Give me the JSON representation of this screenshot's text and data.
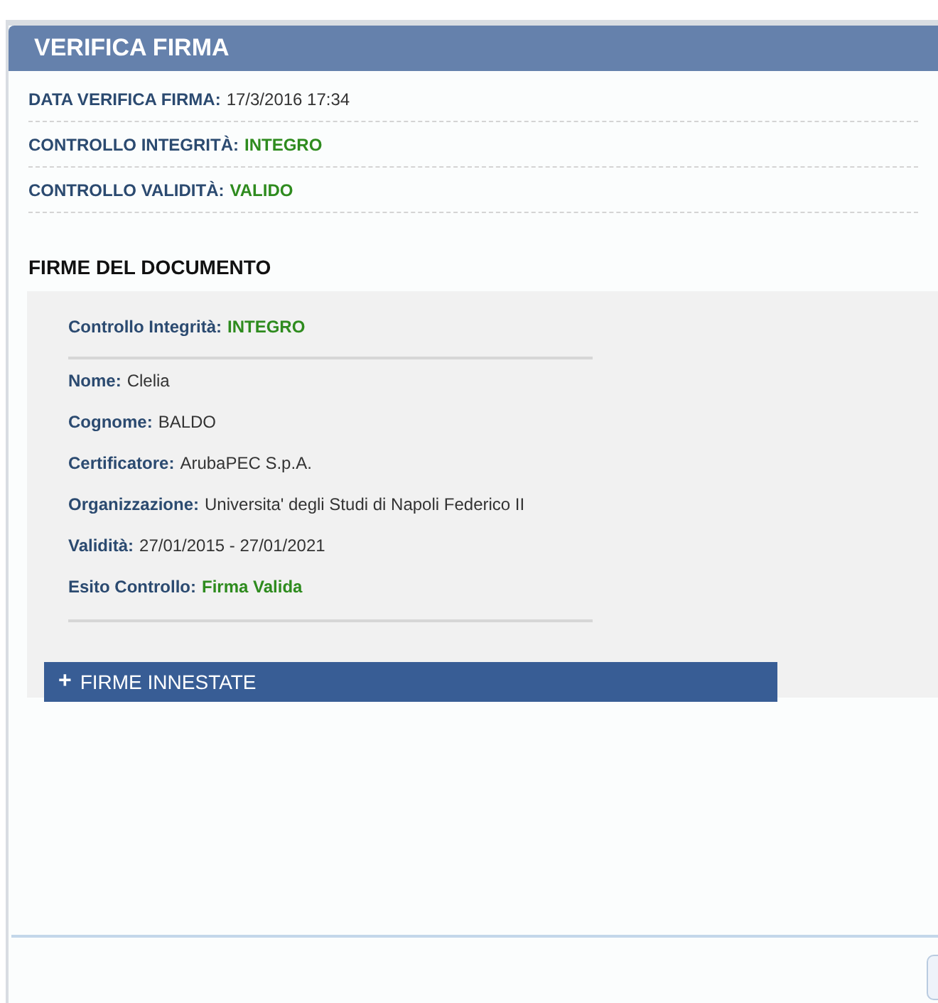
{
  "dialog": {
    "title": "VERIFICA FIRMA"
  },
  "summary": [
    {
      "label": "DATA VERIFICA FIRMA:",
      "value": "17/3/2016 17:34",
      "kind": "text"
    },
    {
      "label": "CONTROLLO INTEGRITÀ:",
      "value": "INTEGRO",
      "kind": "status"
    },
    {
      "label": "CONTROLLO VALIDITÀ:",
      "value": "VALIDO",
      "kind": "status"
    }
  ],
  "signatures": {
    "title": "FIRME DEL DOCUMENTO",
    "integrity": {
      "label": "Controllo Integrità:",
      "value": "INTEGRO",
      "kind": "status"
    },
    "fields": [
      {
        "label": "Nome:",
        "value": "Clelia",
        "kind": "text"
      },
      {
        "label": "Cognome:",
        "value": "BALDO",
        "kind": "text"
      },
      {
        "label": "Certificatore:",
        "value": "ArubaPEC S.p.A.",
        "kind": "text"
      },
      {
        "label": "Organizzazione:",
        "value": "Universita' degli Studi di Napoli Federico II",
        "kind": "text"
      },
      {
        "label": "Validità:",
        "value": "27/01/2015 - 27/01/2021",
        "kind": "text"
      },
      {
        "label": "Esito Controllo:",
        "value": "Firma Valida",
        "kind": "status"
      }
    ],
    "nested_button": {
      "icon": "+",
      "label": "FIRME INNESTATE"
    }
  }
}
